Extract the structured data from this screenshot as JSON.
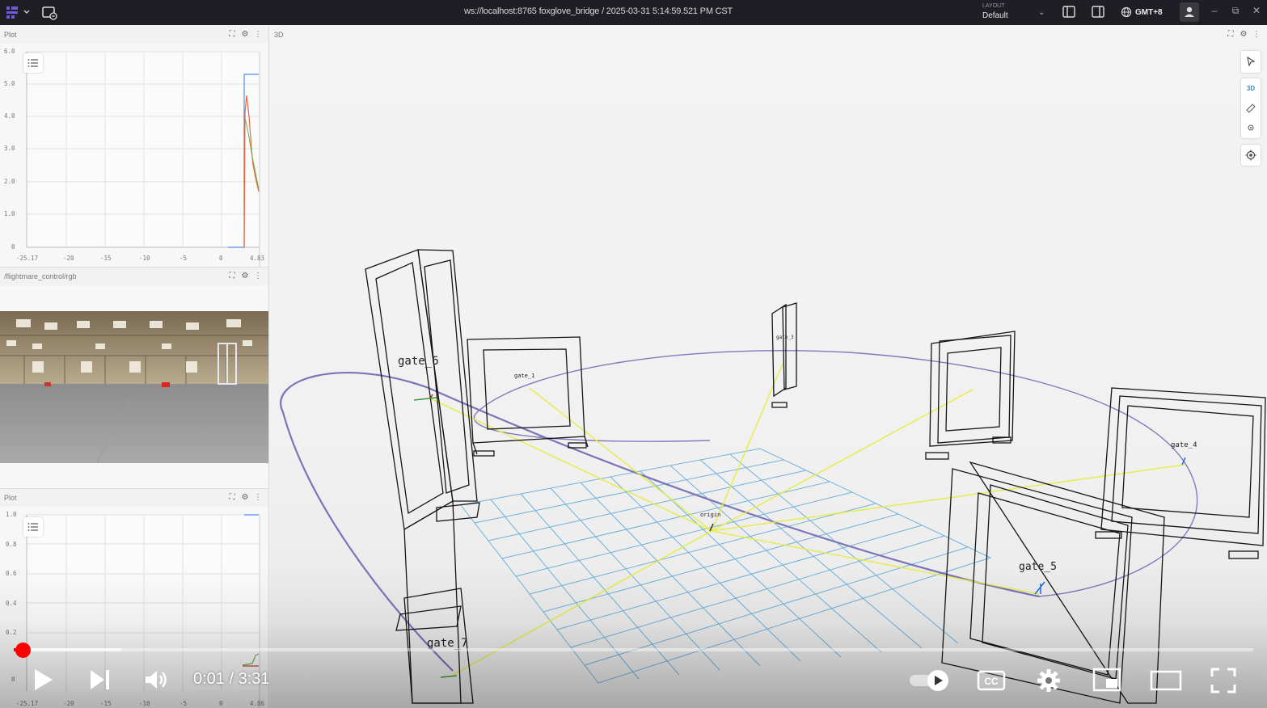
{
  "topbar": {
    "connection_title": "ws://localhost:8765 foxglove_bridge / 2025-03-31 5:14:59.521 PM CST",
    "layout_caption": "LAYOUT",
    "layout_value": "Default",
    "timezone": "GMT+8"
  },
  "plot_top": {
    "title": "Plot",
    "y_ticks": [
      "6.0",
      "5.0",
      "4.0",
      "3.0",
      "2.0",
      "1.0",
      "0"
    ],
    "x_ticks": [
      "-25.17",
      "-20",
      "-15",
      "-10",
      "-5",
      "0",
      "4.83"
    ]
  },
  "camera_panel": {
    "title": "/flightmare_control/rgb"
  },
  "plot_bottom": {
    "title": "Plot",
    "y_ticks": [
      "1.0",
      "0.8",
      "0.6",
      "0.4",
      "0.2",
      "0"
    ],
    "x_ticks": [
      "-25.17",
      "-20",
      "-15",
      "-10",
      "-5",
      "0",
      "4.86"
    ]
  },
  "view3d": {
    "title": "3D",
    "mode_label": "3D",
    "gate_labels": {
      "gate_6": "gate_6",
      "gate_1": "gate_1",
      "gate_3": "gate_3",
      "gate_4": "gate_4",
      "gate_5": "gate_5",
      "gate_7": "gate_7",
      "origin": "origin"
    }
  },
  "video": {
    "time_display": "0:01 / 3:31",
    "progress_played": 0.007,
    "progress_buffered": 0.087,
    "accent_color": "#ff0000"
  }
}
